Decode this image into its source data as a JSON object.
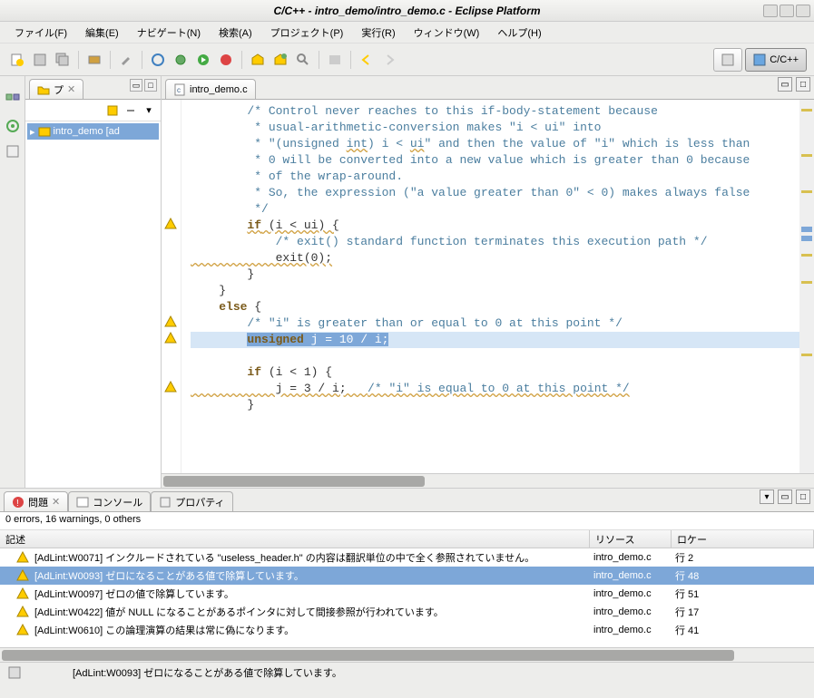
{
  "window": {
    "title": "C/C++ - intro_demo/intro_demo.c - Eclipse Platform"
  },
  "menu": {
    "file": "ファイル(F)",
    "edit": "編集(E)",
    "navigate": "ナビゲート(N)",
    "search": "検索(A)",
    "project": "プロジェクト(P)",
    "run": "実行(R)",
    "window": "ウィンドウ(W)",
    "help": "ヘルプ(H)"
  },
  "perspective": {
    "label": "C/C++"
  },
  "explorer": {
    "tab": "プ",
    "item": "intro_demo [ad"
  },
  "editor": {
    "tab": "intro_demo.c",
    "lines": {
      "c1": "        /* Control never reaches to this if-body-statement because",
      "c2": "         * usual-arithmetic-conversion makes \"i < ui\" into",
      "c3a": "         * \"(unsigned ",
      "c3b": "int",
      "c3c": ") i < ",
      "c3d": "ui",
      "c3e": "\" and then the value of \"i\" which is less than",
      "c4": "         * 0 will be converted into a new value which is greater than 0 because",
      "c5": "         * of the wrap-around.",
      "c6": "         * So, the expression (\"a value greater than 0\" < 0) makes always false",
      "c7": "         */",
      "if1a": "if",
      "if1b": " (i < ui) {",
      "cexit": "            /* exit() standard function terminates this execution path */",
      "exit": "            exit(0);",
      "close1": "        }",
      "close2": "    }",
      "else": "else",
      "elseb": " {",
      "celse": "        /* \"i\" is greater than or equal to 0 at this point */",
      "hl_a": "unsigned",
      "hl_b": " j = 10 / i;",
      "if2a": "if",
      "if2b": " (i < 1) {",
      "j3": "            j = 3 / i;   ",
      "j3c": "/* \"i\" is equal to 0 at this point */",
      "close3": "        }"
    }
  },
  "bottom": {
    "tabs": {
      "problems": "問題",
      "console": "コンソール",
      "properties": "プロパティ"
    },
    "summary": "0 errors, 16 warnings, 0 others",
    "cols": {
      "desc": "記述",
      "resource": "リソース",
      "loc": "ロケー"
    },
    "rows": [
      {
        "desc": "[AdLint:W0071] インクルードされている \"useless_header.h\" の内容は翻訳単位の中で全く参照されていません。",
        "res": "intro_demo.c",
        "loc": "行 2"
      },
      {
        "desc": "[AdLint:W0093] ゼロになることがある値で除算しています。",
        "res": "intro_demo.c",
        "loc": "行 48"
      },
      {
        "desc": "[AdLint:W0097] ゼロの値で除算しています。",
        "res": "intro_demo.c",
        "loc": "行 51"
      },
      {
        "desc": "[AdLint:W0422] 値が NULL になることがあるポインタに対して間接参照が行われています。",
        "res": "intro_demo.c",
        "loc": "行 17"
      },
      {
        "desc": "[AdLint:W0610] この論理演算の結果は常に偽になります。",
        "res": "intro_demo.c",
        "loc": "行 41"
      }
    ]
  },
  "status": {
    "text": "[AdLint:W0093] ゼロになることがある値で除算しています。"
  }
}
